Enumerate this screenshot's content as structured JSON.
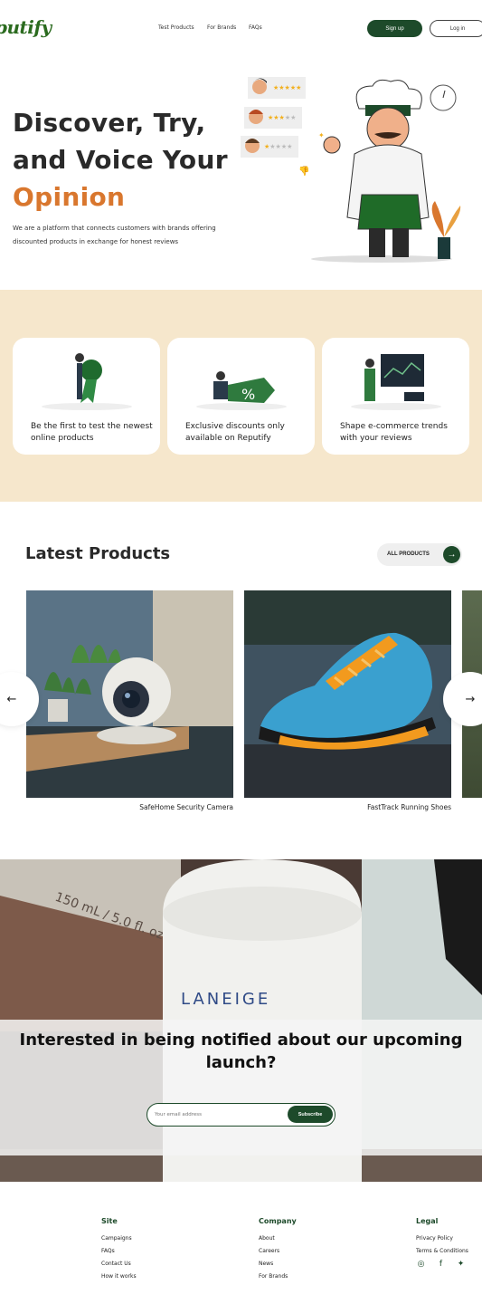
{
  "brand": {
    "logo": "putify",
    "accent": "#1d4a2a",
    "orange": "#d9772e",
    "cream": "#f6e7cc"
  },
  "nav": {
    "links": [
      "Test Products",
      "For Brands",
      "FAQs"
    ],
    "signup": "Sign up",
    "login": "Log in"
  },
  "hero": {
    "title_line1": "Discover,  Try,",
    "title_line2": "and Voice Your",
    "title_accent": "Opinion",
    "desc": "We are a platform that connects customers with brands offering discounted products in exchange for honest reviews"
  },
  "features": [
    {
      "text": "Be the first to test the newest online products",
      "icon": "award-person-illustration"
    },
    {
      "text": "Exclusive discounts only available on Reputify",
      "icon": "discount-tag-illustration"
    },
    {
      "text": "Shape e-commerce trends with your reviews",
      "icon": "analytics-board-illustration"
    }
  ],
  "latest": {
    "title": "Latest Products",
    "all_label": "ALL PRODUCTS",
    "all_arrow": "→",
    "prev_arrow": "←",
    "next_arrow": "→",
    "products": [
      {
        "name": "SafeHome Security Camera"
      },
      {
        "name": "FastTrack Running Shoes"
      }
    ]
  },
  "newsletter": {
    "title": "Interested in being notified about our upcoming launch?",
    "placeholder": "Your email address",
    "button": "Subscribe",
    "bottle_brand": "LANEIGE",
    "bottle_volume": "150 mL / 5.0 fl. oz."
  },
  "footer": {
    "site": {
      "head": "Site",
      "links": [
        "Campaigns",
        "FAQs",
        "Contact Us",
        "How it works"
      ]
    },
    "company": {
      "head": "Company",
      "links": [
        "About",
        "Careers",
        "News",
        "For Brands"
      ]
    },
    "legal": {
      "head": "Legal",
      "links": [
        "Privacy Policy",
        "Terms & Conditions"
      ]
    },
    "social": [
      "instagram-icon",
      "facebook-icon",
      "twitter-icon"
    ]
  }
}
